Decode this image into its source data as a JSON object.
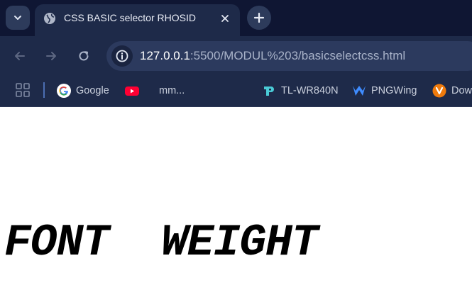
{
  "tab": {
    "title": "CSS BASIC selector RHOSID",
    "favicon": "globe-icon",
    "close_icon": "close-icon"
  },
  "toolbar": {
    "back_icon": "arrow-left-icon",
    "forward_icon": "arrow-right-icon",
    "reload_icon": "reload-icon"
  },
  "omnibox": {
    "url_host": "127.0.0.1",
    "url_rest": ":5500/MODUL%203/basicselectcss.html",
    "site_info_icon": "info-icon"
  },
  "bookmarks": [
    {
      "label": "Google",
      "icon": "google-icon"
    },
    {
      "label": "",
      "icon": "youtube-icon"
    },
    {
      "label": "mm...",
      "icon": ""
    },
    {
      "label": "TL-WR840N",
      "icon": "tplink-icon"
    },
    {
      "label": "PNGWing",
      "icon": "pngwing-icon"
    },
    {
      "label": "Dow",
      "icon": "download-icon"
    }
  ],
  "page": {
    "heading": "FONT  WEIGHT"
  },
  "colors": {
    "tabstrip_bg": "#0f1633",
    "toolbar_bg": "#1e2a49",
    "omnibox_bg": "#2c3a5e",
    "page_bg": "#ffffff",
    "heading_color": "#000000"
  }
}
